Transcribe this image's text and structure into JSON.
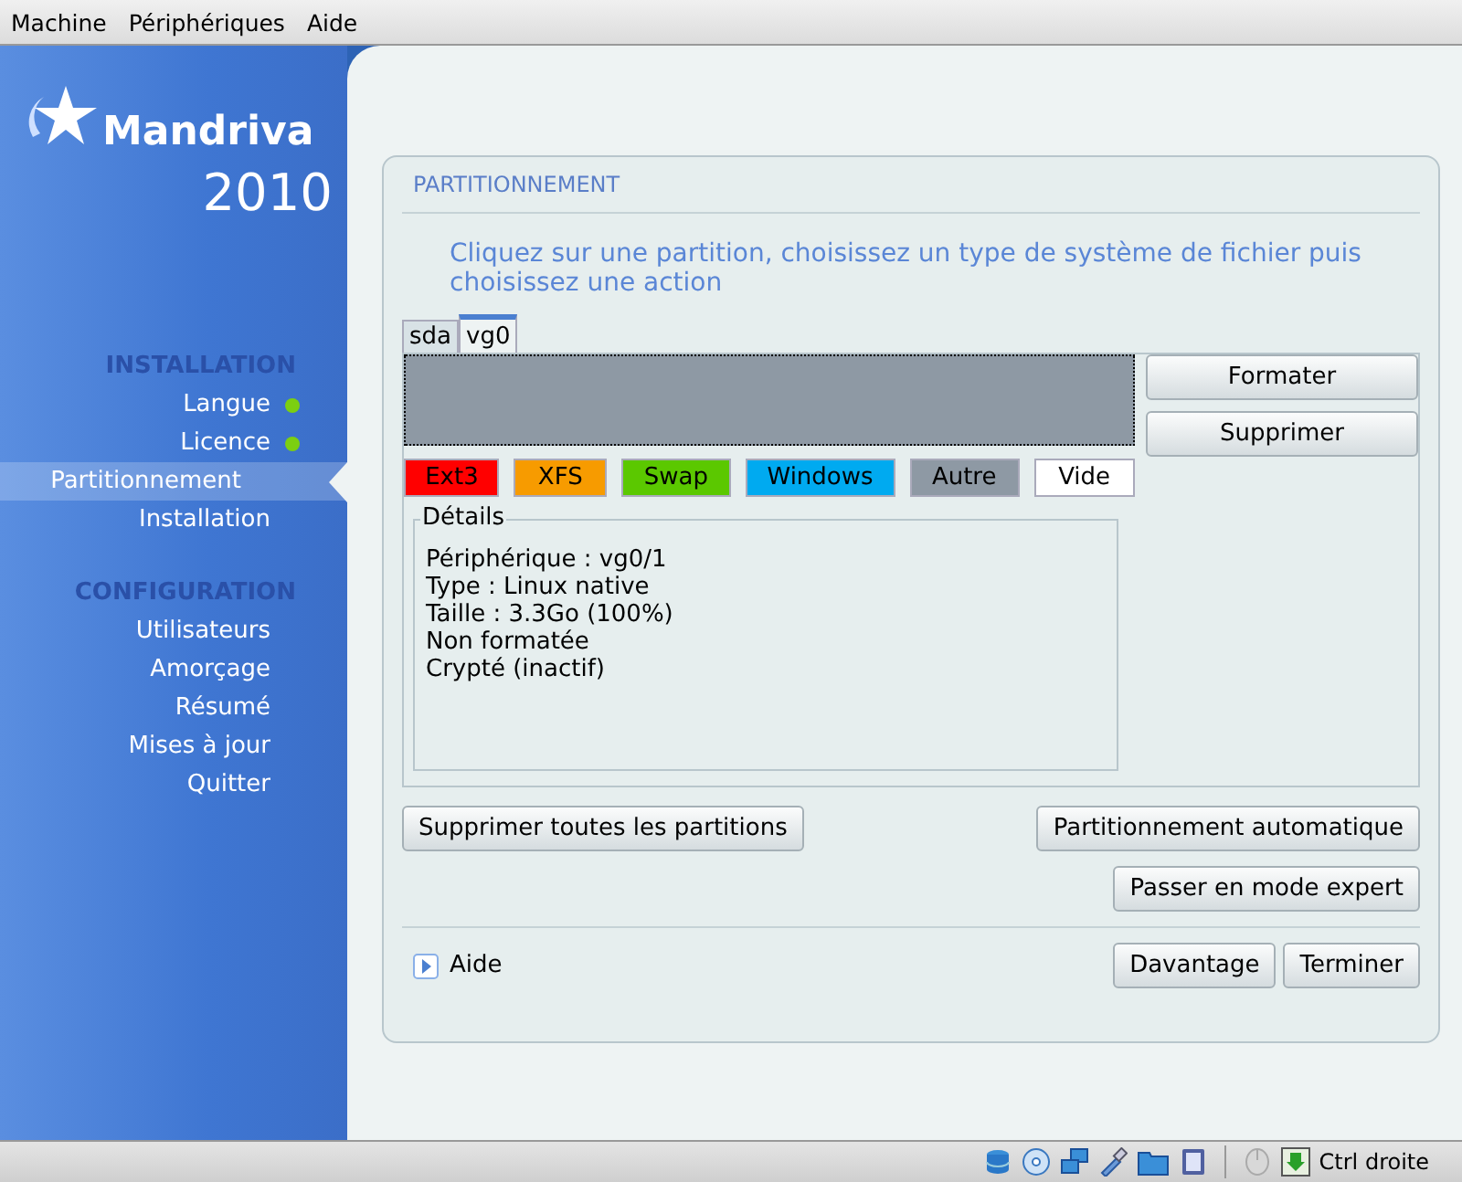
{
  "menu": [
    "Machine",
    "Périphériques",
    "Aide"
  ],
  "logo": {
    "brand": "Mandriva",
    "version": "2010"
  },
  "sidebar": [
    {
      "heading": "INSTALLATION",
      "items": [
        {
          "label": "Langue",
          "done": true,
          "selected": false
        },
        {
          "label": "Licence",
          "done": true,
          "selected": false
        },
        {
          "label": "Partitionnement",
          "done": false,
          "selected": true
        },
        {
          "label": "Installation",
          "done": false,
          "selected": false
        }
      ]
    },
    {
      "heading": "CONFIGURATION",
      "items": [
        {
          "label": "Utilisateurs",
          "done": false,
          "selected": false
        },
        {
          "label": "Amorçage",
          "done": false,
          "selected": false
        },
        {
          "label": "Résumé",
          "done": false,
          "selected": false
        },
        {
          "label": "Mises à jour",
          "done": false,
          "selected": false
        },
        {
          "label": "Quitter",
          "done": false,
          "selected": false
        }
      ]
    }
  ],
  "panel": {
    "title": "PARTITIONNEMENT",
    "instruction": "Cliquez sur une partition, choisissez un type de système de fichier puis choisissez une action",
    "disk_tabs": [
      {
        "label": "sda",
        "selected": false
      },
      {
        "label": "vg0",
        "selected": true
      }
    ],
    "partitions": [
      {
        "color": "#8e99a4",
        "selected": true
      }
    ],
    "actions": [
      "Formater",
      "Supprimer"
    ],
    "legend": [
      {
        "label": "Ext3",
        "color": "#ff0000"
      },
      {
        "label": "XFS",
        "color": "#f79b00"
      },
      {
        "label": "Swap",
        "color": "#5bc800"
      },
      {
        "label": "Windows",
        "color": "#00aaf0"
      },
      {
        "label": "Autre",
        "color": "#8e99a4"
      },
      {
        "label": "Vide",
        "color": "#ffffff"
      }
    ],
    "details": {
      "title": "Détails",
      "lines": [
        "Périphérique : vg0/1",
        "Type : Linux native",
        "Taille : 3.3Go (100%)",
        "Non formatée",
        "Crypté (inactif)"
      ]
    },
    "buttons_left": [
      "Supprimer toutes les partitions"
    ],
    "buttons_right": [
      "Partitionnement automatique",
      "Passer en mode expert"
    ],
    "help": "Aide",
    "footer_buttons": [
      "Davantage",
      "Terminer"
    ]
  },
  "status_bar": {
    "host_key": "Ctrl droite"
  }
}
